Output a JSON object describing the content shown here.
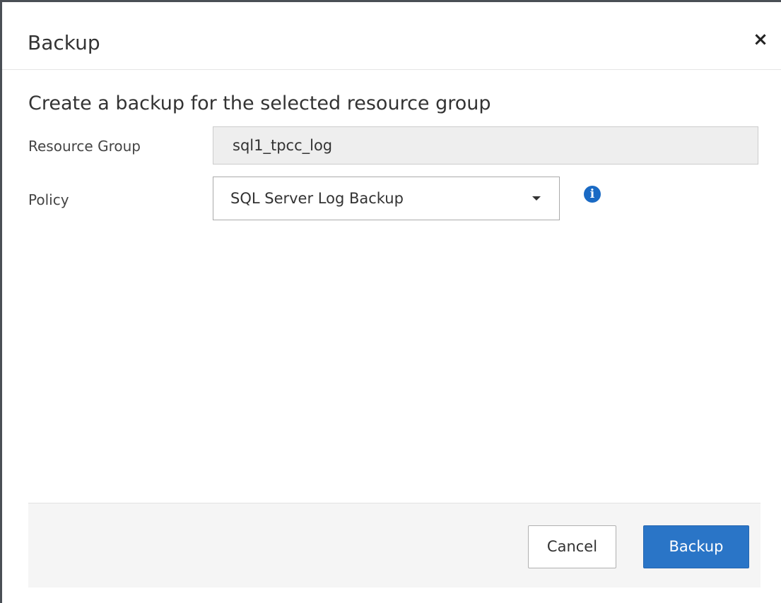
{
  "dialog": {
    "title": "Backup",
    "close_icon": "×",
    "subtitle": "Create a backup for the selected resource group"
  },
  "form": {
    "resource_group_label": "Resource Group",
    "resource_group_value": "sql1_tpcc_log",
    "policy_label": "Policy",
    "policy_selected": "SQL Server Log Backup",
    "info_icon": "i"
  },
  "footer": {
    "cancel_label": "Cancel",
    "backup_label": "Backup"
  },
  "colors": {
    "primary": "#2a75c7",
    "info": "#1a6ac4",
    "footer_bg": "#f5f5f5",
    "readonly_field_bg": "#eeeeee"
  },
  "icons": {
    "close": "close-icon",
    "dropdown": "caret-down-icon",
    "info": "info-icon"
  }
}
